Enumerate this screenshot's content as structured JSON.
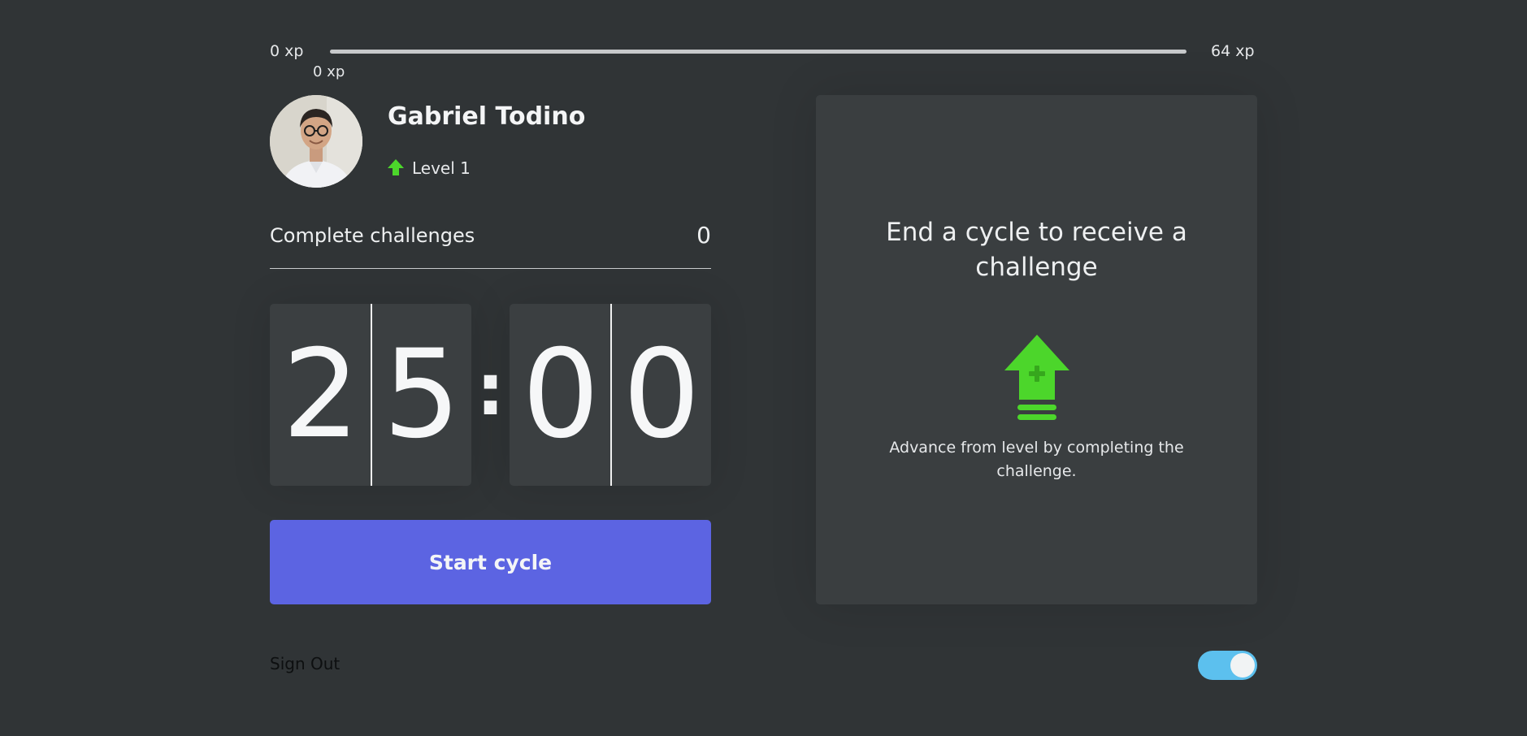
{
  "experience": {
    "min_label": "0 xp",
    "max_label": "64 xp",
    "current_label": "0 xp",
    "current_fraction": 0
  },
  "profile": {
    "name": "Gabriel Todino",
    "level_label": "Level 1",
    "level_icon": "level-up-arrow-icon"
  },
  "completed_challenges": {
    "label": "Complete challenges",
    "count": "0"
  },
  "countdown": {
    "minute_left": "2",
    "minute_right": "5",
    "separator": ":",
    "second_left": "0",
    "second_right": "0"
  },
  "start_button": {
    "label": "Start cycle"
  },
  "challenge_card": {
    "title": "End a cycle to receive a challenge",
    "icon": "level-up-arrow-icon",
    "description": "Advance from level by completing the challenge."
  },
  "footer": {
    "sign_out_label": "Sign Out",
    "theme_toggle_on": true
  },
  "colors": {
    "background": "#303436",
    "card": "#3a3e40",
    "accent_button": "#5c64e2",
    "level_green": "#4cd62b",
    "toggle_blue": "#5cc0ee"
  }
}
